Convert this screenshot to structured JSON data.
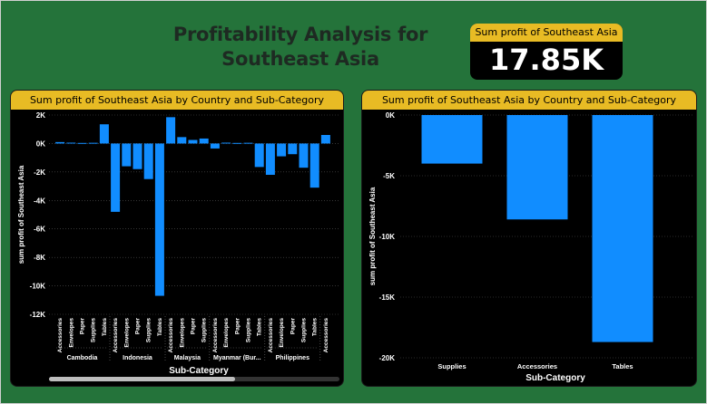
{
  "header": {
    "title_line1": "Profitability Analysis for",
    "title_line2": "Southeast Asia"
  },
  "kpi": {
    "title": "Sum profit of Southeast Asia",
    "value": "17.85K"
  },
  "colors": {
    "background": "#24733a",
    "panel": "#000000",
    "header_bar": "#e8bb24",
    "bar": "#118dff"
  },
  "left_chart": {
    "title": "Sum profit of Southeast Asia by Country and Sub-Category"
  },
  "right_chart": {
    "title": "Sum profit of Southeast Asia by Country and Sub-Category"
  },
  "chart_data": [
    {
      "type": "bar",
      "title": "Sum profit of Southeast Asia by Country and Sub-Category",
      "xlabel": "Sub-Category",
      "ylabel": "sum profit of Southeast Asia",
      "ylim": [
        -12000,
        2000
      ],
      "yticks": [
        2000,
        0,
        -2000,
        -4000,
        -6000,
        -8000,
        -10000,
        -12000
      ],
      "ytick_labels": [
        "2K",
        "0K",
        "-2K",
        "-4K",
        "-6K",
        "-8K",
        "-10K",
        "-12K"
      ],
      "grid": true,
      "groups": [
        {
          "name": "Cambodia",
          "categories": [
            "Accessories",
            "Envelopes",
            "Paper",
            "Supplies",
            "Tables"
          ],
          "values": [
            100,
            60,
            40,
            50,
            1350
          ]
        },
        {
          "name": "Indonesia",
          "categories": [
            "Accessories",
            "Envelopes",
            "Paper",
            "Supplies",
            "Tables"
          ],
          "values": [
            -4800,
            -1600,
            -1800,
            -2500,
            -10700
          ]
        },
        {
          "name": "Malaysia",
          "categories": [
            "Accessories",
            "Envelopes",
            "Paper",
            "Supplies"
          ],
          "values": [
            1850,
            450,
            250,
            350
          ]
        },
        {
          "name": "Myanmar (Bur...",
          "categories": [
            "Accessories",
            "Envelopes",
            "Paper",
            "Supplies",
            "Tables"
          ],
          "values": [
            -350,
            60,
            40,
            50,
            -1650
          ]
        },
        {
          "name": "Philippines",
          "categories": [
            "Accessories",
            "Envelopes",
            "Paper",
            "Supplies",
            "Tables"
          ],
          "values": [
            -2200,
            -900,
            -750,
            -1700,
            -3100
          ]
        },
        {
          "name": "",
          "categories": [
            "Accessories"
          ],
          "values": [
            600
          ]
        }
      ]
    },
    {
      "type": "bar",
      "title": "Sum profit of Southeast Asia by Country and Sub-Category",
      "xlabel": "Sub-Category",
      "ylabel": "sum profit of Southeast Asia",
      "ylim": [
        -20000,
        0
      ],
      "yticks": [
        0,
        -5000,
        -10000,
        -15000,
        -20000
      ],
      "ytick_labels": [
        "0K",
        "-5K",
        "-10K",
        "-15K",
        "-20K"
      ],
      "grid": true,
      "categories": [
        "Supplies",
        "Accessories",
        "Tables"
      ],
      "values": [
        -4000,
        -8600,
        -18700
      ]
    }
  ]
}
